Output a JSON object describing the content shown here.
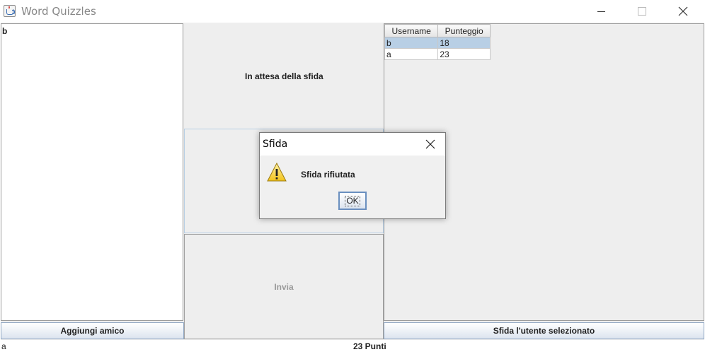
{
  "window": {
    "title": "Word Quizzles"
  },
  "friends": {
    "items": [
      "b"
    ],
    "add_button": "Aggiungi amico"
  },
  "game": {
    "status": "In attesa della sfida",
    "send_label": "Invia"
  },
  "ranking": {
    "columns": [
      "Username",
      "Punteggio"
    ],
    "rows": [
      {
        "username": "b",
        "score": "18",
        "selected": true
      },
      {
        "username": "a",
        "score": "23",
        "selected": false
      }
    ],
    "challenge_button": "Sfida l'utente selezionato"
  },
  "footer": {
    "user": "a",
    "points": "23 Punti"
  },
  "dialog": {
    "title": "Sfida",
    "message": "Sfida rifiutata",
    "ok_label": "OK",
    "icon": "warning-icon"
  },
  "colors": {
    "selection": "#b8cfe5",
    "background": "#eeeeee",
    "button_border": "#8fa6c2"
  }
}
